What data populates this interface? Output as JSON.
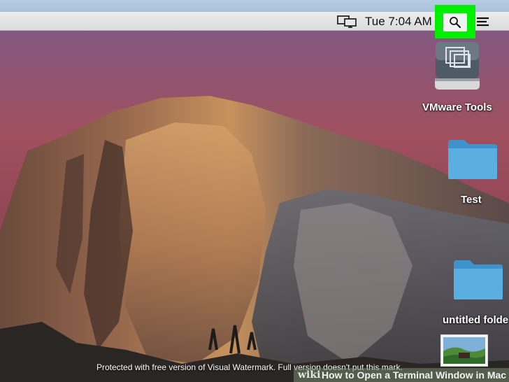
{
  "menu_bar": {
    "clock": "Tue 7:04 AM",
    "display_icon": "display-mirroring-icon",
    "spotlight_icon": "search-icon",
    "notification_icon": "menu-lines-icon",
    "highlight_color": "#00ee00"
  },
  "desktop": {
    "icons": [
      {
        "label": "VMware Tools",
        "icon": "disk-image-icon"
      },
      {
        "label": "Test",
        "icon": "folder-icon"
      },
      {
        "label": "untitled folde",
        "icon": "folder-icon"
      },
      {
        "label": "",
        "icon": "image-file-icon"
      }
    ],
    "folder_color": "#4ea3d8"
  },
  "watermark": {
    "text": "Protected with free version of Visual Watermark. Full version doesn't put this mark.",
    "wikihow_logo": "wiki",
    "wikihow_title": "How to Open a Terminal Window in Mac"
  }
}
